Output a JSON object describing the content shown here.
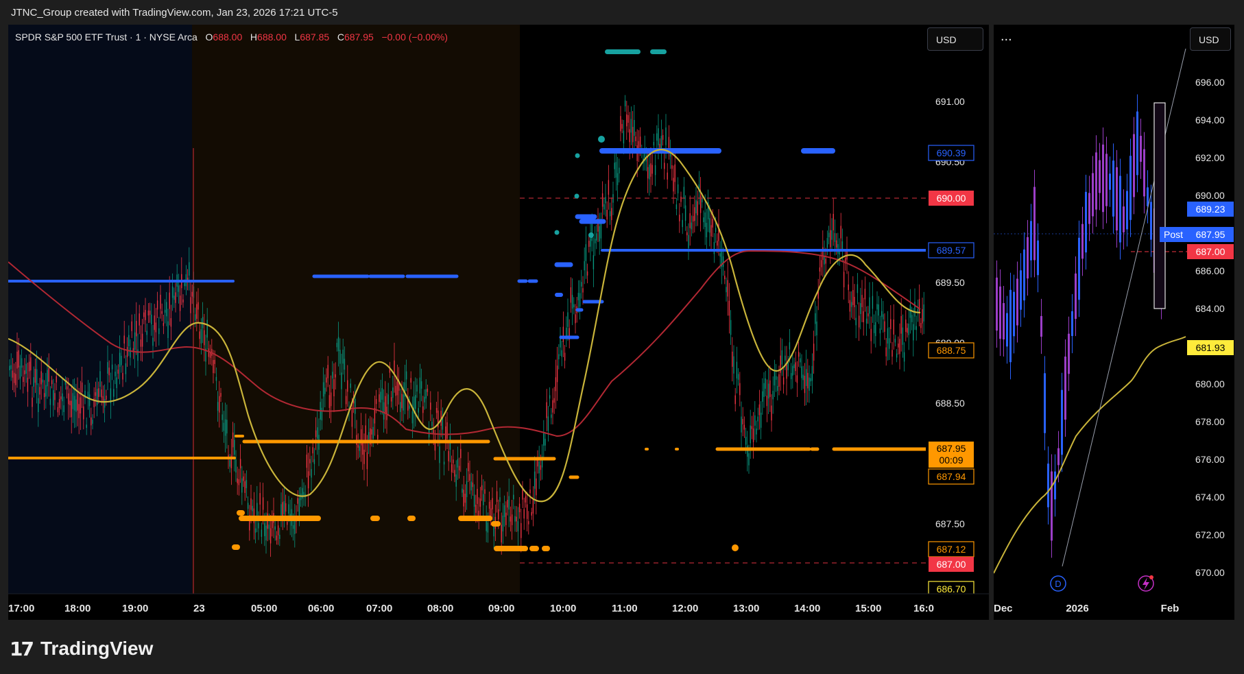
{
  "header": {
    "caption": "JTNC_Group created with TradingView.com, Jan 23, 2026 17:21 UTC-5"
  },
  "main_chart": {
    "symbol": "SPDR S&P 500 ETF Trust · 1 · NYSE Arca",
    "open_label": "O",
    "open": "688.00",
    "high_label": "H",
    "high": "688.00",
    "low_label": "L",
    "low": "687.85",
    "close_label": "C",
    "close": "687.95",
    "change": "−0.00 (−0.00%)",
    "currency": "USD",
    "price_ticks": [
      "691.00",
      "690.50",
      "689.50",
      "689.00",
      "688.50",
      "687.50"
    ],
    "time_ticks": [
      "17:00",
      "18:00",
      "19:00",
      "23",
      "05:00",
      "06:00",
      "07:00",
      "08:00",
      "09:00",
      "10:00",
      "11:00",
      "12:00",
      "13:00",
      "14:00",
      "15:00",
      "16:0"
    ],
    "price_tags": {
      "blue_upper": "690.39",
      "red_upper": "690.00",
      "blue_mid": "689.57",
      "orange_outline": "688.75",
      "last_price": "687.95",
      "countdown": "00:09",
      "orange_outline2": "687.94",
      "orange_outline3": "687.12",
      "red_lower": "687.00",
      "yellow_outline": "686.70"
    }
  },
  "side_chart": {
    "menu_dots": "...",
    "currency": "USD",
    "price_ticks": [
      "696.00",
      "694.00",
      "692.00",
      "690.00",
      "686.00",
      "684.00",
      "680.00",
      "678.00",
      "676.00",
      "674.00",
      "672.00",
      "670.00"
    ],
    "time_ticks": [
      "Dec",
      "2026",
      "Feb"
    ],
    "price_tags": {
      "blue": "689.23",
      "post_label": "Post",
      "post_price": "687.95",
      "red": "687.00",
      "yellow": "681.93"
    },
    "event_d": "D"
  },
  "branding": {
    "name": "TradingView"
  },
  "colors": {
    "up": "#089981",
    "down": "#f23645",
    "blue": "#2962ff",
    "orange": "#ff9800",
    "yellow": "#c9b43a",
    "maroon": "#b22833"
  }
}
